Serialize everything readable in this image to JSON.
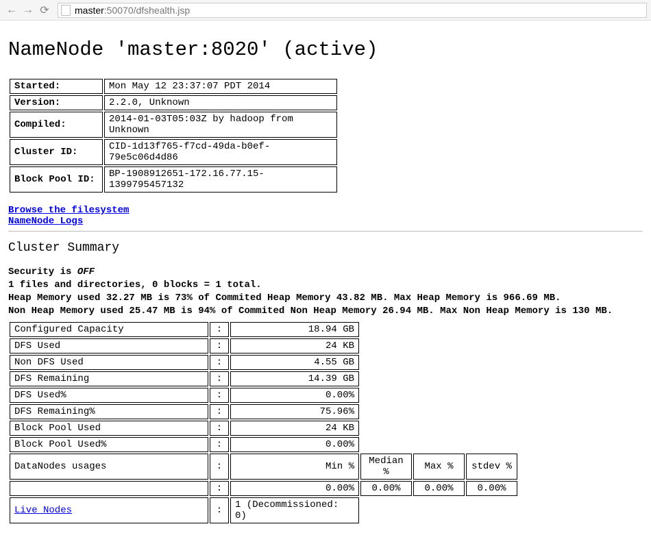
{
  "browser": {
    "url_host": "master",
    "url_path": ":50070/dfshealth.jsp"
  },
  "title": "NameNode 'master:8020' (active)",
  "info_rows": [
    {
      "label": "Started:",
      "value": "Mon May 12 23:37:07 PDT 2014"
    },
    {
      "label": "Version:",
      "value": "2.2.0, Unknown"
    },
    {
      "label": "Compiled:",
      "value": "2014-01-03T05:03Z by hadoop from Unknown"
    },
    {
      "label": "Cluster ID:",
      "value": "CID-1d13f765-f7cd-49da-b0ef-79e5c06d4d86"
    },
    {
      "label": "Block Pool ID:",
      "value": "BP-1908912651-172.16.77.15-1399795457132"
    }
  ],
  "links": {
    "browse": "Browse the filesystem",
    "logs": "NameNode Logs"
  },
  "section_header": "Cluster Summary",
  "security_prefix": "Security is ",
  "security_state": "OFF",
  "files_line": "1 files and directories, 0 blocks = 1 total.",
  "heap_line": "Heap Memory used 32.27 MB is 73% of Commited Heap Memory 43.82 MB. Max Heap Memory is 966.69 MB.",
  "nonheap_line": "Non Heap Memory used 25.47 MB is 94% of Commited Non Heap Memory 26.94 MB. Max Non Heap Memory is 130 MB.",
  "summary_rows": [
    {
      "k": "Configured Capacity",
      "v": "18.94 GB"
    },
    {
      "k": "DFS Used",
      "v": "24 KB"
    },
    {
      "k": "Non DFS Used",
      "v": "4.55 GB"
    },
    {
      "k": "DFS Remaining",
      "v": "14.39 GB"
    },
    {
      "k": "DFS Used%",
      "v": "0.00%"
    },
    {
      "k": "DFS Remaining%",
      "v": "75.96%"
    },
    {
      "k": "Block Pool Used",
      "v": "24 KB"
    },
    {
      "k": "Block Pool Used%",
      "v": "0.00%"
    }
  ],
  "usages_label": "DataNodes usages",
  "usages_headers": {
    "min": "Min %",
    "median": "Median %",
    "max": "Max %",
    "stdev": "stdev %"
  },
  "usages_values": {
    "min": "0.00%",
    "median": "0.00%",
    "max": "0.00%",
    "stdev": "0.00%"
  },
  "live_label": "Live Nodes",
  "live_value": "1 (Decommissioned: 0)"
}
